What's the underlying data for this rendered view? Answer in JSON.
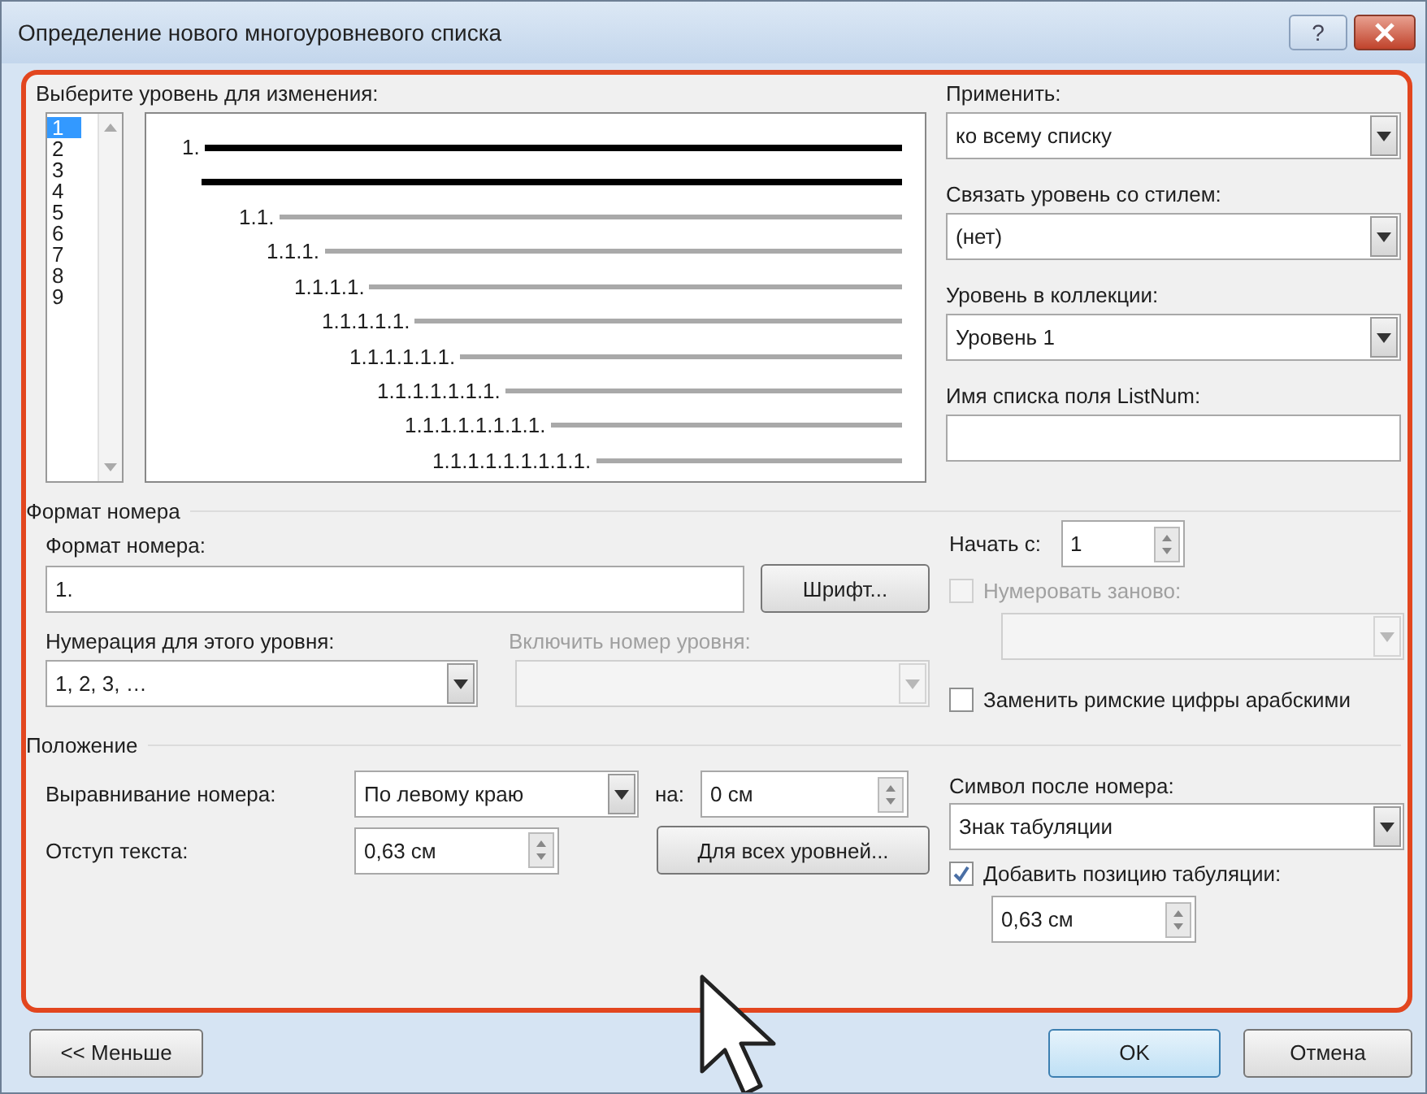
{
  "window": {
    "title": "Определение нового многоуровневого списка",
    "help_button": "?"
  },
  "level_picker": {
    "label": "Выберите уровень для изменения:",
    "levels": [
      {
        "label": "1",
        "selected": true
      },
      {
        "label": "2",
        "selected": false
      },
      {
        "label": "3",
        "selected": false
      },
      {
        "label": "4",
        "selected": false
      },
      {
        "label": "5",
        "selected": false
      },
      {
        "label": "6",
        "selected": false
      },
      {
        "label": "7",
        "selected": false
      },
      {
        "label": "8",
        "selected": false
      },
      {
        "label": "9",
        "selected": false
      }
    ]
  },
  "preview": {
    "items": [
      {
        "number": "1.",
        "selected": true
      },
      {
        "number": "1.1.",
        "selected": false
      },
      {
        "number": "1.1.1.",
        "selected": false
      },
      {
        "number": "1.1.1.1.",
        "selected": false
      },
      {
        "number": "1.1.1.1.1.",
        "selected": false
      },
      {
        "number": "1.1.1.1.1.1.",
        "selected": false
      },
      {
        "number": "1.1.1.1.1.1.1.",
        "selected": false
      },
      {
        "number": "1.1.1.1.1.1.1.1.",
        "selected": false
      },
      {
        "number": "1.1.1.1.1.1.1.1.1.",
        "selected": false
      }
    ]
  },
  "apply": {
    "label": "Применить:",
    "value": "ко всему списку"
  },
  "link_style": {
    "label": "Связать уровень со стилем:",
    "value": "(нет)"
  },
  "gallery_level": {
    "label": "Уровень в коллекции:",
    "value": "Уровень 1"
  },
  "listnum_name": {
    "label": "Имя списка поля ListNum:"
  },
  "number_format": {
    "section": "Формат номера",
    "format_label": "Формат номера:",
    "format_value": "1.",
    "font_button": "Шрифт...",
    "style_label": "Нумерация для этого уровня:",
    "style_value": "1, 2, 3, …",
    "include_label": "Включить номер уровня:",
    "include_disabled": true,
    "start_label": "Начать с:",
    "start_value": "1",
    "restart": {
      "label": "Нумеровать заново:",
      "checked": false,
      "disabled": true
    },
    "legal": {
      "label": "Заменить римские цифры арабскими",
      "checked": false,
      "disabled": false
    }
  },
  "position": {
    "section": "Положение",
    "align_label": "Выравнивание номера:",
    "align_value": "По левому краю",
    "at_label": "на:",
    "at_value": "0 см",
    "indent_label": "Отступ текста:",
    "indent_value": "0,63 см",
    "all_levels_button": "Для всех уровней...",
    "follow_label": "Символ после номера:",
    "follow_value": "Знак табуляции",
    "add_tab": {
      "label": "Добавить позицию табуляции:",
      "checked": true,
      "disabled": false
    },
    "tab_value": "0,63 см"
  },
  "buttons": {
    "less": "<< Меньше",
    "ok": "OK",
    "cancel": "Отмена"
  }
}
